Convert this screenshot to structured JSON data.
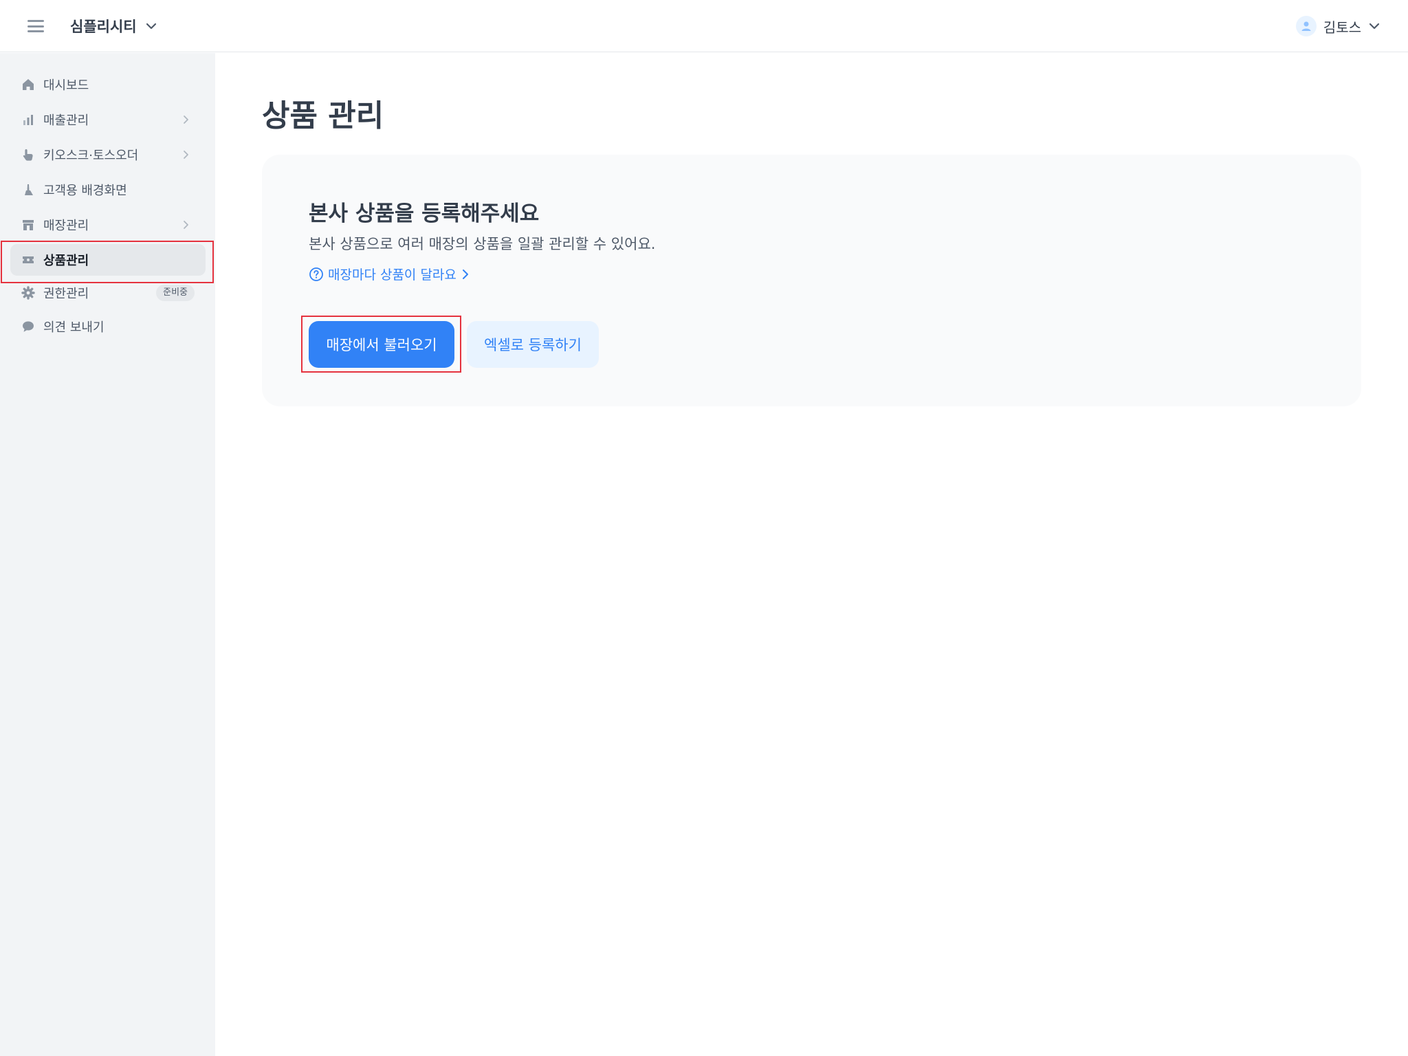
{
  "header": {
    "org_name": "심플리시티",
    "user_name": "김토스"
  },
  "sidebar": {
    "items": [
      {
        "label": "대시보드",
        "icon": "home-icon"
      },
      {
        "label": "매출관리",
        "icon": "bar-chart-icon",
        "has_arrow": true
      },
      {
        "label": "키오스크·토스오더",
        "icon": "pointer-hand-icon",
        "has_arrow": true
      },
      {
        "label": "고객용 배경화면",
        "icon": "brush-icon"
      },
      {
        "label": "매장관리",
        "icon": "store-icon",
        "has_arrow": true
      },
      {
        "label": "상품관리",
        "icon": "ticket-icon",
        "active": true
      },
      {
        "label": "권한관리",
        "icon": "gear-icon",
        "badge": "준비중"
      },
      {
        "label": "의견 보내기",
        "icon": "chat-bubble-icon"
      }
    ]
  },
  "main": {
    "title": "상품 관리",
    "card": {
      "title": "본사 상품을 등록해주세요",
      "description": "본사 상품으로 여러 매장의 상품을 일괄 관리할 수 있어요.",
      "help_link": "매장마다 상품이 달라요",
      "primary_button": "매장에서 불러오기",
      "secondary_button": "엑셀로 등록하기"
    }
  },
  "colors": {
    "accent": "#3182f6",
    "accent_light": "#e8f3ff",
    "highlight": "#e5323e",
    "sidebar_bg": "#f2f4f6"
  }
}
